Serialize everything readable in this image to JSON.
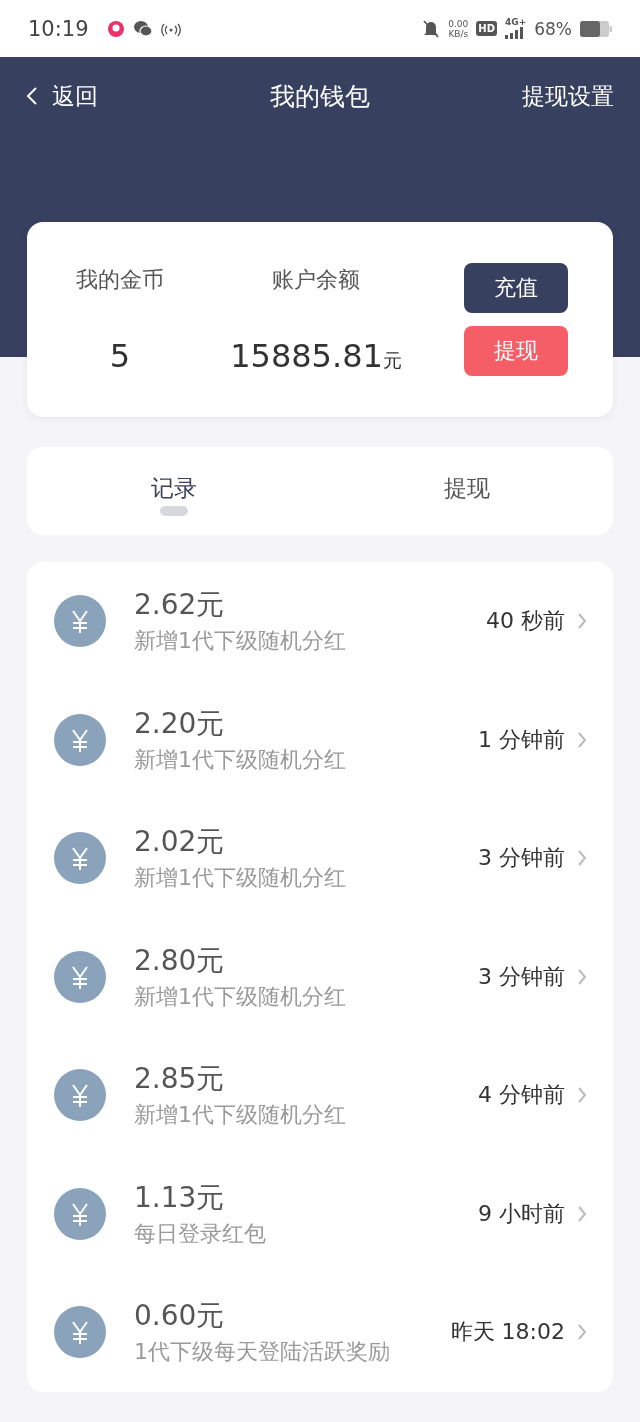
{
  "status_bar": {
    "time": "10:19",
    "net_speed": "0.00",
    "net_unit": "KB/s",
    "hd": "HD",
    "network": "4G+",
    "battery": "68%"
  },
  "nav": {
    "back": "返回",
    "title": "我的钱包",
    "action": "提现设置"
  },
  "wallet": {
    "coins_label": "我的金币",
    "coins": "5",
    "balance_label": "账户余额",
    "balance": "15885.81",
    "balance_unit": "元",
    "buttons": [
      {
        "label": "充值",
        "kind": "dark"
      },
      {
        "label": "提现",
        "kind": "red"
      }
    ]
  },
  "tabs": [
    {
      "label": "记录",
      "selected": true
    },
    {
      "label": "提现",
      "selected": false
    }
  ],
  "records": [
    {
      "amount": "2.62元",
      "desc": "新增1代下级随机分红",
      "time": "40 秒前"
    },
    {
      "amount": "2.20元",
      "desc": "新增1代下级随机分红",
      "time": "1 分钟前"
    },
    {
      "amount": "2.02元",
      "desc": "新增1代下级随机分红",
      "time": "3 分钟前"
    },
    {
      "amount": "2.80元",
      "desc": "新增1代下级随机分红",
      "time": "3 分钟前"
    },
    {
      "amount": "2.85元",
      "desc": "新增1代下级随机分红",
      "time": "4 分钟前"
    },
    {
      "amount": "1.13元",
      "desc": "每日登录红包",
      "time": "9 小时前"
    },
    {
      "amount": "0.60元",
      "desc": "1代下级每天登陆活跃奖励",
      "time": "昨天 18:02"
    }
  ]
}
